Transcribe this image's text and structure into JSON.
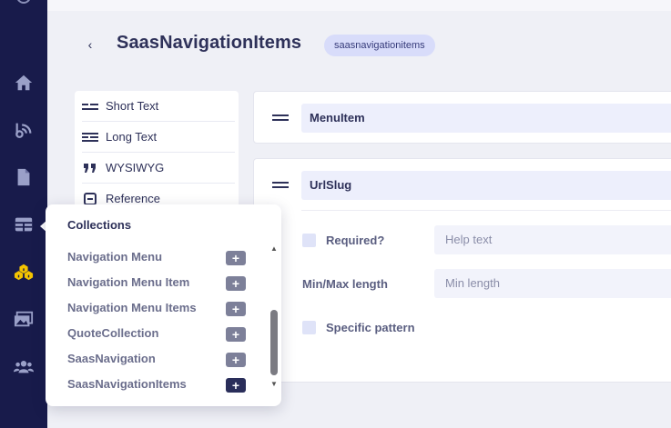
{
  "header": {
    "title": "SaasNavigationItems",
    "slug": "saasnavigationitems",
    "back_glyph": "‹"
  },
  "field_types": [
    {
      "label": "Short Text",
      "icon": "short-text-icon"
    },
    {
      "label": "Long Text",
      "icon": "long-text-icon"
    },
    {
      "label": "WYSIWYG",
      "icon": "quote-icon"
    },
    {
      "label": "Reference",
      "icon": "reference-icon"
    }
  ],
  "fields": [
    {
      "name": "MenuItem"
    },
    {
      "name": "UrlSlug",
      "required_label": "Required?",
      "help_placeholder": "Help text",
      "minmax_label": "Min/Max length",
      "min_placeholder": "Min length",
      "pattern_label": "Specific pattern"
    }
  ],
  "collections": {
    "title": "Collections",
    "add_glyph": "+",
    "items": [
      {
        "label": "Navigation Menu"
      },
      {
        "label": "Navigation Menu Item"
      },
      {
        "label": "Navigation Menu Items"
      },
      {
        "label": "QuoteCollection"
      },
      {
        "label": "SaasNavigation"
      },
      {
        "label": "SaasNavigationItems",
        "active": true
      }
    ]
  },
  "sidebar": {
    "items": [
      "home-icon",
      "blog-icon",
      "document-icon",
      "table-icon",
      "collections-icon",
      "media-icon",
      "users-icon"
    ],
    "active_color": "#f5c400"
  }
}
